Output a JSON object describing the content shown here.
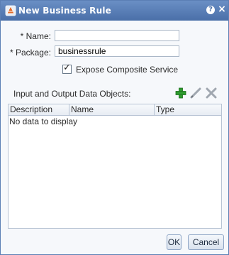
{
  "dialog": {
    "title": "New Business Rule",
    "help_label": "?",
    "close_label": "×"
  },
  "form": {
    "name_label": "* Name:",
    "name_value": "",
    "package_label": "* Package:",
    "package_value": "businessrule",
    "expose_label": "Expose Composite Service",
    "expose_checked": true
  },
  "data_objects": {
    "section_label": "Input and Output Data Objects:",
    "columns": [
      "Description",
      "Name",
      "Type"
    ],
    "empty_message": "No data to display"
  },
  "footer": {
    "ok_label": "OK",
    "cancel_label": "Cancel"
  },
  "colors": {
    "titlebar": "#4a6fa8",
    "add_icon": "#2e9b2e"
  },
  "icons": {
    "title": "rule-icon",
    "add": "add-icon",
    "edit": "edit-icon",
    "delete": "delete-icon"
  }
}
